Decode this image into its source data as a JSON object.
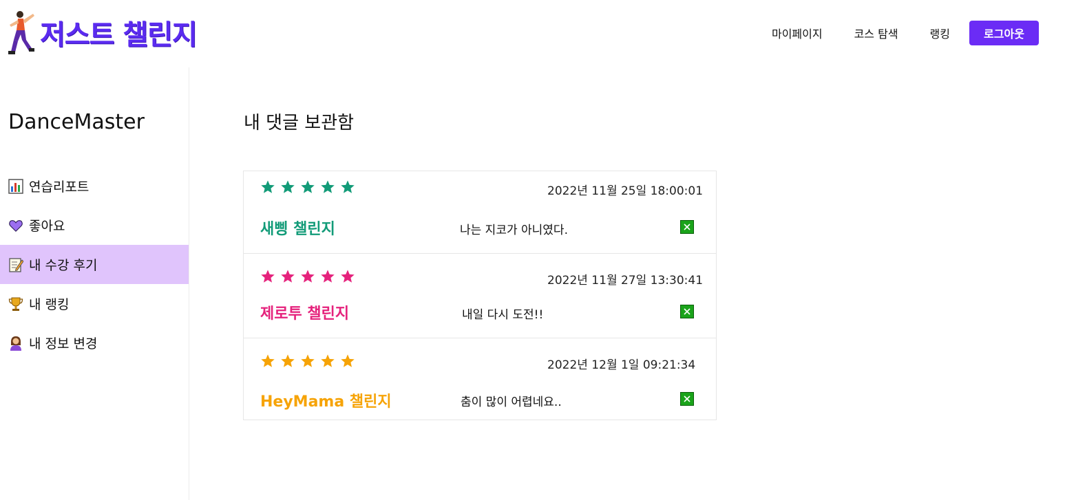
{
  "header": {
    "logo_text": "저스트 챌린지",
    "nav": {
      "mypage": "마이페이지",
      "course_search": "코스 탐색",
      "ranking": "랭킹",
      "logout": "로그아웃"
    }
  },
  "sidebar": {
    "username": "DanceMaster",
    "items": [
      {
        "icon": "chart-icon",
        "label": "연습리포트",
        "active": false
      },
      {
        "icon": "purple-heart-icon",
        "label": "좋아요",
        "active": false
      },
      {
        "icon": "memo-icon",
        "label": "내 수강 후기",
        "active": true
      },
      {
        "icon": "trophy-icon",
        "label": "내 랭킹",
        "active": false
      },
      {
        "icon": "person-icon",
        "label": "내 정보 변경",
        "active": false
      }
    ]
  },
  "main": {
    "title": "내 댓글 보관함",
    "reviews": [
      {
        "rating": 5,
        "color": "#129b78",
        "date": "2022년 11월 25일 18:00:01",
        "course": "새삥 챌린지",
        "comment": "나는 지코가 아니였다."
      },
      {
        "rating": 5,
        "color": "#e5227c",
        "date": "2022년 11월 27일 13:30:41",
        "course": "제로투 챌린지",
        "comment": "내일 다시 도전!!"
      },
      {
        "rating": 5,
        "color": "#f6a306",
        "date": "2022년 12월 1일 09:21:34",
        "course": "HeyMama 챌린지",
        "comment": "춤이 많이 어렵네요.."
      }
    ]
  },
  "colors": {
    "brand": "#5b2bf0",
    "logout_button": "#6b2cf5",
    "active_menu": "#e0c4fc",
    "delete_button": "#1aa31a"
  }
}
